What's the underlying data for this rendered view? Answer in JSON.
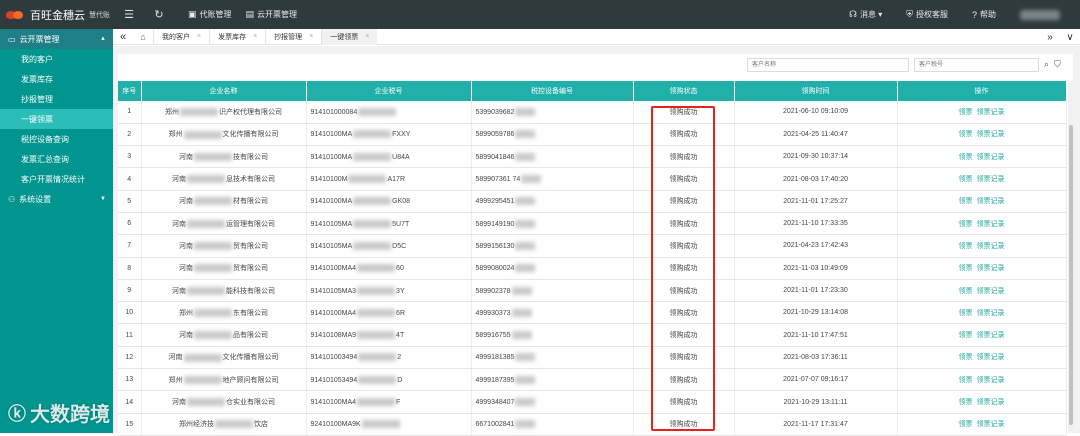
{
  "brand": {
    "name": "百旺金穗云",
    "sub": "慧代账"
  },
  "topbar": {
    "menu_icon": "☰",
    "refresh_icon": "↻",
    "menus": [
      {
        "icon": "▣",
        "label": "代账管理"
      },
      {
        "icon": "▤",
        "label": "云开票管理"
      }
    ],
    "right": [
      {
        "icon": "☊",
        "label": "消息 ▾"
      },
      {
        "icon": "⛨",
        "label": "授权客服"
      },
      {
        "icon": "?",
        "label": "帮助"
      }
    ]
  },
  "sidebar": {
    "group1": {
      "icon": "▭",
      "label": "云开票管理"
    },
    "items": [
      "我的客户",
      "发票库存",
      "抄报管理",
      "一键领票",
      "税控设备查询",
      "发票汇总查询",
      "客户开票情况统计"
    ],
    "active_index": 3,
    "group2": {
      "icon": "⚇",
      "label": "系统设置"
    }
  },
  "tabs": {
    "left_nav": "«",
    "home": "⌂",
    "items": [
      "我的客户",
      "发票库存",
      "抄报管理",
      "一键领票"
    ],
    "active_index": 3,
    "right_nav": "»",
    "right_more": "∨"
  },
  "search": {
    "customer_placeholder": "客户名称",
    "tax_placeholder": "客户税号"
  },
  "table": {
    "headers": [
      "序号",
      "企业名称",
      "企业税号",
      "税控设备编号",
      "领购状态",
      "领购时间",
      "操作"
    ],
    "rows": [
      {
        "no": "1",
        "name_a": "郑州",
        "name_b": "识产权代理有限公司",
        "tax_a": "914101000084",
        "tax_b": "",
        "dev_a": "5399039682",
        "time": "2021-06-10 09:10:09"
      },
      {
        "no": "2",
        "name_a": "郑州",
        "name_b": "文化传播有限公司",
        "tax_a": "91410100MA",
        "tax_b": "FXXY",
        "dev_a": "5899059786",
        "time": "2021-04-25 11:40:47"
      },
      {
        "no": "3",
        "name_a": "河南",
        "name_b": "技有限公司",
        "tax_a": "91410100MA",
        "tax_b": "U84A",
        "dev_a": "5899041846",
        "time": "2021-09-30 10:37:14"
      },
      {
        "no": "4",
        "name_a": "河南",
        "name_b": "息技术有限公司",
        "tax_a": "91410100M",
        "tax_b": "A17R",
        "dev_a": "589907361 74",
        "time": "2021-08-03 17:40:20"
      },
      {
        "no": "5",
        "name_a": "河南",
        "name_b": "材有限公司",
        "tax_a": "91410100MA",
        "tax_b": "GK08",
        "dev_a": "4999295451",
        "time": "2021-11-01 17:25:27"
      },
      {
        "no": "6",
        "name_a": "河南",
        "name_b": "运管理有限公司",
        "tax_a": "91410105MA",
        "tax_b": "5U7T",
        "dev_a": "5899149190",
        "time": "2021-11-10 17:33:35"
      },
      {
        "no": "7",
        "name_a": "河南",
        "name_b": "贸有限公司",
        "tax_a": "91410105MA",
        "tax_b": "D5C",
        "dev_a": "5899156130",
        "time": "2021-04-23 17:42:43"
      },
      {
        "no": "8",
        "name_a": "河南",
        "name_b": "贸有限公司",
        "tax_a": "91410100MA4",
        "tax_b": "60",
        "dev_a": "5899080024",
        "time": "2021-11-03 10:49:09"
      },
      {
        "no": "9",
        "name_a": "河南",
        "name_b": "能科技有限公司",
        "tax_a": "91410105MA3",
        "tax_b": "3Y",
        "dev_a": "589902378",
        "time": "2021-11-01 17:23:30"
      },
      {
        "no": "10",
        "name_a": "郑州",
        "name_b": "东有限公司",
        "tax_a": "91410100MA4",
        "tax_b": "6R",
        "dev_a": "499930373",
        "time": "2021-10-29 13:14:08"
      },
      {
        "no": "11",
        "name_a": "河南",
        "name_b": "品有限公司",
        "tax_a": "91410108MA9",
        "tax_b": "4T",
        "dev_a": "589916755",
        "time": "2021-11-10 17:47:51"
      },
      {
        "no": "12",
        "name_a": "河南",
        "name_b": "文化传播有限公司",
        "tax_a": "914101003494",
        "tax_b": "2",
        "dev_a": "4999181385",
        "time": "2021-08-03 17:36:11"
      },
      {
        "no": "13",
        "name_a": "郑州",
        "name_b": "地产顾问有限公司",
        "tax_a": "914101053494",
        "tax_b": "D",
        "dev_a": "4999187395",
        "time": "2021-07-07 09:16:17"
      },
      {
        "no": "14",
        "name_a": "河南",
        "name_b": "仓实业有限公司",
        "tax_a": "91410100MA4",
        "tax_b": "F",
        "dev_a": "4999348407",
        "time": "2021-10-29 13:11:11"
      },
      {
        "no": "15",
        "name_a": "郑州经济技",
        "name_b": "饮店",
        "tax_a": "92410100MA9K",
        "tax_b": "",
        "dev_a": "6671002841",
        "time": "2021-11-17 17:31:47"
      }
    ],
    "status": "领购成功",
    "op1": "领票",
    "op2": "领票记录"
  },
  "watermark": {
    "icon": "ⓚ",
    "text": "大数跨境"
  },
  "colors": {
    "topbar": "#2f3a3c",
    "sidebar": "#00958e",
    "header": "#21b0a9",
    "link": "#1ea69f",
    "highlight": "#e8211d"
  }
}
